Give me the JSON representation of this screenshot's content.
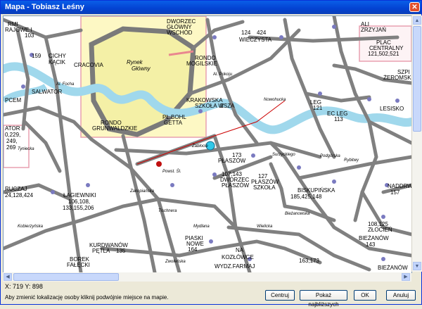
{
  "window": {
    "title": "Mapa - Tobiasz Leśny",
    "close_glyph": "✕"
  },
  "status": {
    "coords": "X: 719  Y: 898",
    "hint": "Aby zmienić lokalizację osoby kliknij podwójnie miejsce na mapie."
  },
  "buttons": {
    "center": "Centruj",
    "nearest": "Pokaż najbliższych",
    "ok": "OK",
    "cancel": "Anuluj"
  },
  "colors": {
    "road": "#808080",
    "river": "#a0d8ec",
    "old_town": "#fdf8c4",
    "district_border": "#e8a0b0"
  },
  "map_labels": {
    "l1": "RMI",
    "l2": "RAJOWE I",
    "l3": "103",
    "l4": "DWORZEC",
    "l5": "GŁÓWNY",
    "l6": "WSCHÓD",
    "l7": "124",
    "l8": "424",
    "l9": "WIECZYSTA",
    "l10": "ALI",
    "l11": "ZRZYJAŃ",
    "l12": "PLAC",
    "l13": "CENTRALNY",
    "l14": "121,502,521",
    "l15": "159",
    "l16": "CICHY",
    "l17": "KĄCIK",
    "l18": "CRACOVIA",
    "l19": "Rynek",
    "l20": "Główny",
    "l21": "RONDO",
    "l22": "MOGILSKIE",
    "l23": "Al. Pokoju",
    "l24": "SZPI",
    "l25": "ŻEROMSKIE",
    "l26": "PCEM",
    "l27": "SALWATOR",
    "l28": "KRAKOWSKA",
    "l29": "SZKOŁA W",
    "l30": "ZSZA",
    "l31": "LEG",
    "l32": "121",
    "l33": "EC LEG",
    "l34": "113",
    "l35": "LESISKO",
    "l36": "ATOR",
    "l37": "0,229,",
    "l38": "249,",
    "l39": "269",
    "l40": "RONDO",
    "l41": "GRUNWALDZKIE",
    "l42": "PL.BOHL",
    "l43": "GETTA",
    "l44": "173",
    "l45": "PŁASZÓW",
    "l46": "107,143",
    "l47": "DWORZEC",
    "l48": "PŁASZÓW",
    "l49": "127",
    "l50": "PŁASZÓW",
    "l51": "SZKOŁA",
    "l52": "BISKUPIŃSKA",
    "l53": "185,425,148",
    "l54": "NADDRW",
    "l55": "157",
    "l56": "RUCZAJ",
    "l57": "24,128,424",
    "l58": "ŁAGIEWNIKI",
    "l59": "106,108,",
    "l60": "133,155,206",
    "l61": "108,125",
    "l62": "ZŁOCIEŃ",
    "l63": "BIEŻANÓW",
    "l64": "143",
    "l65": "PIASKI",
    "l66": "NOWE",
    "l67": "164",
    "l68": "KURDWANÓW",
    "l69": "PĘTLA",
    "l70": "135",
    "l71": "NA",
    "l72": "KOZŁÓWCE",
    "l73": "BOREK",
    "l74": "FAŁĘCKI",
    "l75": "WYDZ.FARMAJ",
    "l76": "163,173",
    "l77": "BIEŻANÓW",
    "l78": "Wielicka",
    "l79": "Bieżanowska",
    "l80": "Powst. Śl.",
    "l81": "Zabłocie",
    "l82": "Surzyckiego",
    "l83": "Rybitwy",
    "l84": "Tyniecka",
    "l85": "Kobierzyńska",
    "l86": "Nowohucka",
    "l87": "Podgórska",
    "l88": "Al. Focha",
    "l89": "Tischnera",
    "l90": "Zakopiańska",
    "l91": "Mydlana",
    "l92": "Zwoleńska"
  }
}
